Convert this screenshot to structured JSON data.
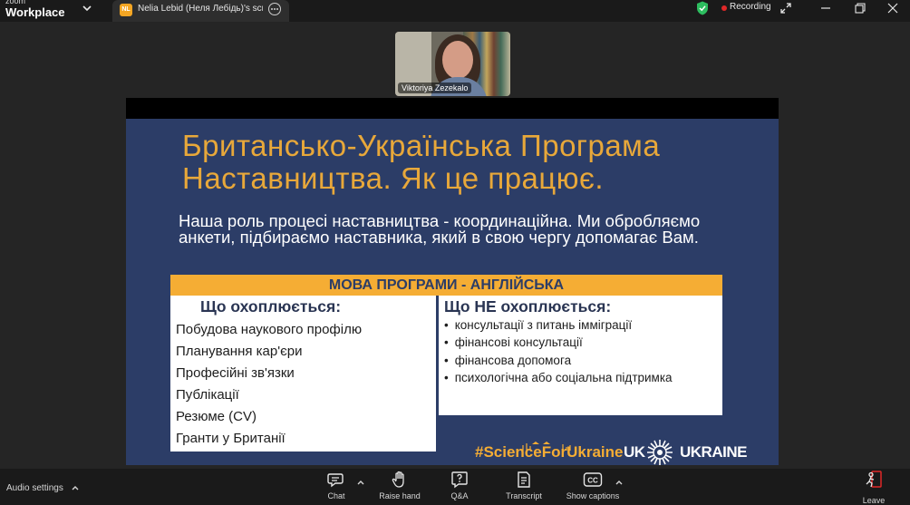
{
  "titlebar": {
    "brand_small": "zoom",
    "brand_large": "Workplace",
    "share_badge": "NL",
    "share_title": "Nelia Lebid (Неля Лебідь)'s screer",
    "recording_label": "Recording"
  },
  "video": {
    "participant_name": "Viktoriya Zezekalo"
  },
  "slide": {
    "title_line1": "Британсько-Українська Програма",
    "title_line2": "Наставництва. Як це працює.",
    "intro": "Наша роль процесі наставництва - координаційна. Ми обробляємо анкети, підбираємо наставника, який в свою чергу допомагає Вам.",
    "language_bar": "МОВА ПРОГРАМИ - АНГЛІЙСЬКА",
    "covered_heading": "Що охоплюється:",
    "covered_items": [
      "Побудова наукового профілю",
      "Планування кар'єри",
      "Професійні зв'язки",
      "Публікації",
      "Резюме (CV)",
      "Гранти у Британії"
    ],
    "not_covered_heading": "Що НЕ охоплюється:",
    "not_covered_items": [
      "консультації з питань імміграції",
      "фінансові консультації",
      "фінансова допомога",
      "психологічна або соціальна підтримка"
    ],
    "hashtag": "#ScienceForUkraine",
    "logo_left": "UK",
    "logo_right": "UKRAINE",
    "colors": {
      "background": "#2c3d67",
      "accent": "#f5ad34",
      "title": "#e8a83a"
    }
  },
  "toolbar": {
    "audio_settings": "Audio settings",
    "buttons": {
      "chat": "Chat",
      "raise_hand": "Raise hand",
      "qa": "Q&A",
      "transcript": "Transcript",
      "captions": "Show captions",
      "leave": "Leave"
    },
    "cc_icon_text": "CC"
  },
  "status_colors": {
    "recording": "#e02828",
    "shield": "#2dbd5f"
  }
}
